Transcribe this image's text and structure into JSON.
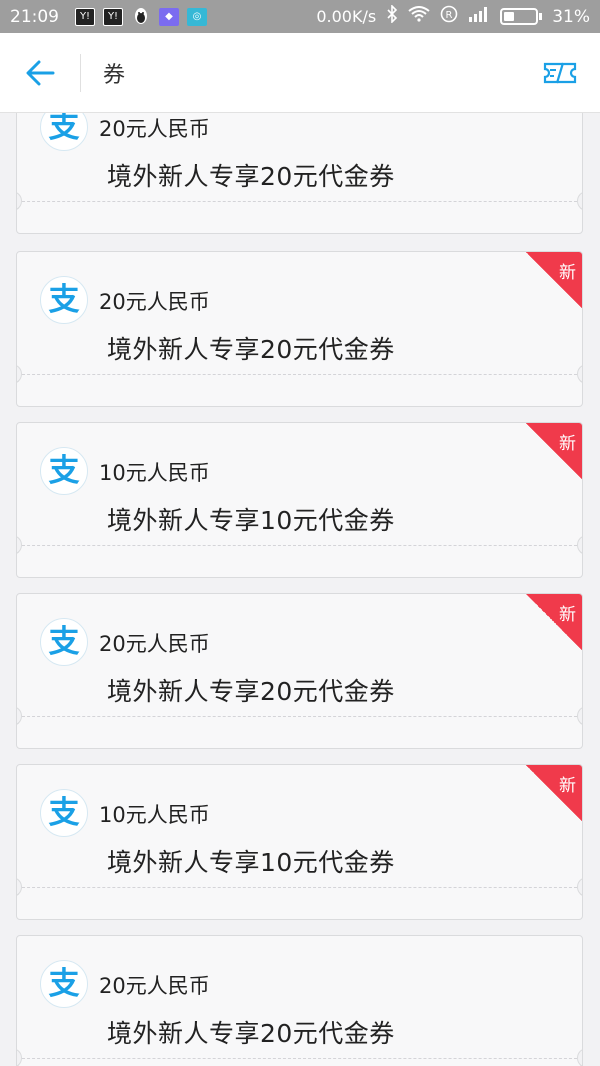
{
  "status_bar": {
    "time": "21:09",
    "net_speed": "0.00K/s",
    "battery": "31%",
    "battery_level": 0.31
  },
  "header": {
    "title": "券",
    "back_icon": "arrow-left-icon",
    "right_icon": "coupon-ticket-icon"
  },
  "colors": {
    "accent": "#1aa0e6",
    "new_badge": "#f03a4b"
  },
  "coupons": [
    {
      "amount": "20元人民币",
      "name": "境外新人专享20元代金券",
      "logo": "支",
      "badge": ""
    },
    {
      "amount": "20元人民币",
      "name": "境外新人专享20元代金券",
      "logo": "支",
      "badge": "新"
    },
    {
      "amount": "10元人民币",
      "name": "境外新人专享10元代金券",
      "logo": "支",
      "badge": "新"
    },
    {
      "amount": "20元人民币",
      "name": "境外新人专享20元代金券",
      "logo": "支",
      "badge": "新"
    },
    {
      "amount": "10元人民币",
      "name": "境外新人专享10元代金券",
      "logo": "支",
      "badge": "新"
    },
    {
      "amount": "20元人民币",
      "name": "境外新人专享20元代金券",
      "logo": "支",
      "badge": ""
    }
  ]
}
